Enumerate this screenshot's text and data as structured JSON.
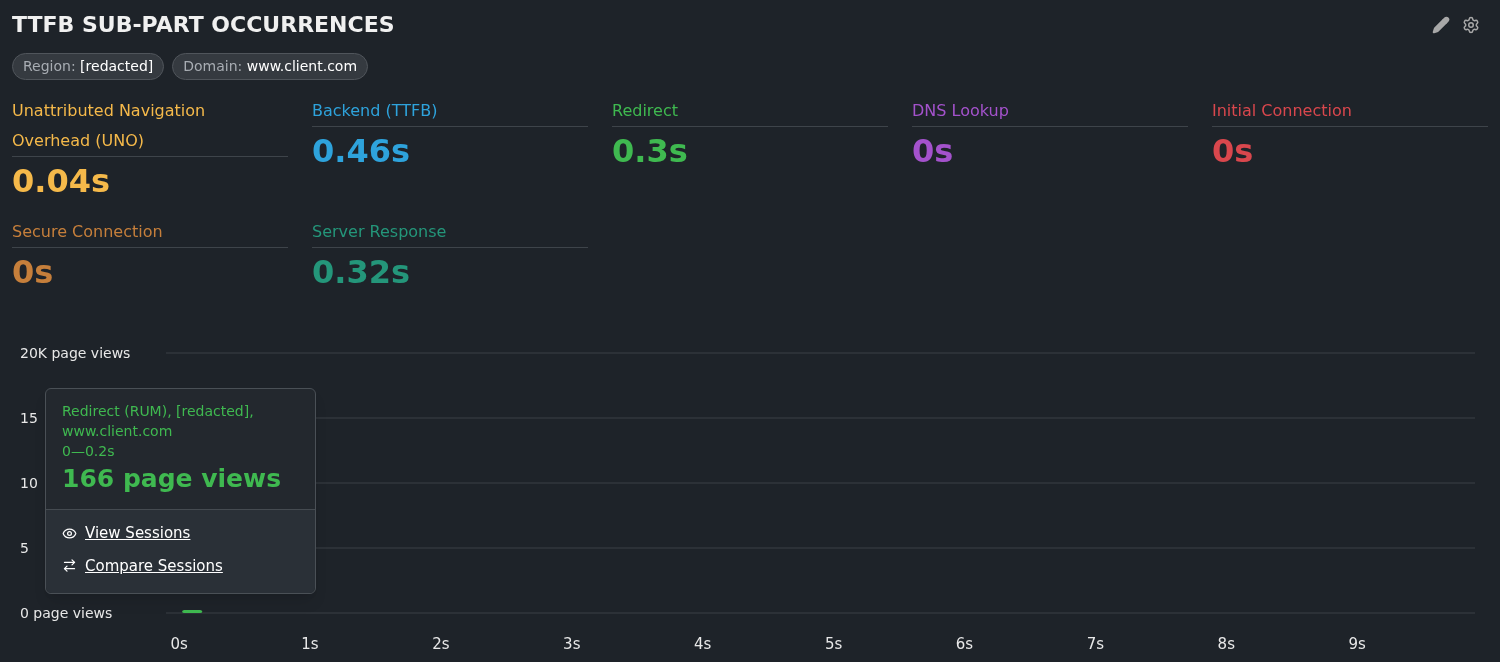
{
  "title": "TTFB SUB-PART OCCURRENCES",
  "filters": [
    {
      "label": "Region:",
      "value": "[redacted]"
    },
    {
      "label": "Domain:",
      "value": "www.client.com"
    }
  ],
  "metrics": [
    {
      "label": "Unattributed Navigation Overhead (UNO)",
      "value": "0.04s",
      "color": "#f5b94a"
    },
    {
      "label": "Backend (TTFB)",
      "value": "0.46s",
      "color": "#2ea3dc"
    },
    {
      "label": "Redirect",
      "value": "0.3s",
      "color": "#3fb950"
    },
    {
      "label": "DNS Lookup",
      "value": "0s",
      "color": "#a452cc"
    },
    {
      "label": "Initial Connection",
      "value": "0s",
      "color": "#d9474d"
    },
    {
      "label": "Secure Connection",
      "value": "0s",
      "color": "#c67f3b"
    },
    {
      "label": "Server Response",
      "value": "0.32s",
      "color": "#24967a"
    }
  ],
  "chart": {
    "chart_data": {
      "type": "bar",
      "x": [
        0.1
      ],
      "xlim": [
        -0.1,
        9.9
      ],
      "ylim": [
        0,
        20000
      ],
      "xticks": [
        {
          "value": 0,
          "label": "0s"
        },
        {
          "value": 1,
          "label": "1s"
        },
        {
          "value": 2,
          "label": "2s"
        },
        {
          "value": 3,
          "label": "3s"
        },
        {
          "value": 4,
          "label": "4s"
        },
        {
          "value": 5,
          "label": "5s"
        },
        {
          "value": 6,
          "label": "6s"
        },
        {
          "value": 7,
          "label": "7s"
        },
        {
          "value": 8,
          "label": "8s"
        },
        {
          "value": 9,
          "label": "9s"
        }
      ],
      "yticks": [
        {
          "value": 20000,
          "label": "20K page views"
        },
        {
          "value": 0,
          "label": "0 page views"
        }
      ],
      "series": [
        {
          "color": "#3fb950",
          "values": [
            166
          ]
        }
      ]
    },
    "covered_tick_labels": [
      "15",
      "10",
      "5"
    ],
    "tooltip": {
      "lines": [
        "Redirect (RUM), [redacted],",
        "www.client.com",
        "0—0.2s"
      ],
      "count": "166 page views",
      "actions": [
        "View Sessions",
        "Compare Sessions"
      ]
    }
  }
}
